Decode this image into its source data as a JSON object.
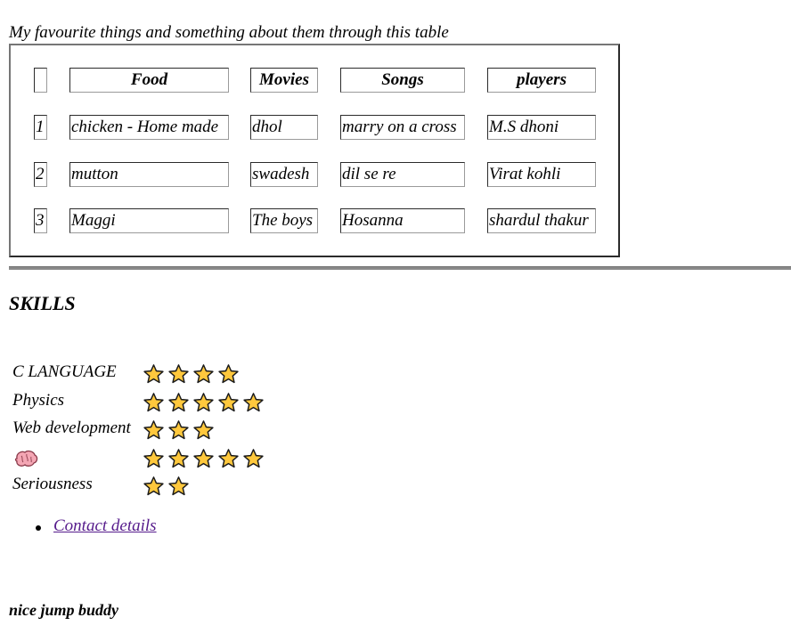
{
  "caption": "My favourite things and something about them through this table",
  "table": {
    "headers": [
      "",
      "Food",
      "Movies",
      "Songs",
      "players"
    ],
    "rows": [
      [
        "1",
        "chicken - Home made",
        "dhol",
        "marry on a cross",
        "M.S dhoni"
      ],
      [
        "2",
        "mutton",
        "swadesh",
        "dil se re",
        "Virat kohli"
      ],
      [
        "3",
        "Maggi",
        "The boys",
        "Hosanna",
        "shardul thakur"
      ]
    ]
  },
  "skills": {
    "title": "SKILLS",
    "items": [
      {
        "label": "C LANGUAGE",
        "stars": 4
      },
      {
        "label": "Physics",
        "stars": 5
      },
      {
        "label": "Web development",
        "stars": 3
      },
      {
        "label": "",
        "icon": "brain-icon",
        "stars": 5
      },
      {
        "label": "Seriousness",
        "stars": 2
      }
    ]
  },
  "contact_link": "Contact details",
  "footer_text": "nice jump buddy",
  "colors": {
    "star_fill": "#ffc83d",
    "link": "#551a8b",
    "brain": "#f4a6b4"
  }
}
